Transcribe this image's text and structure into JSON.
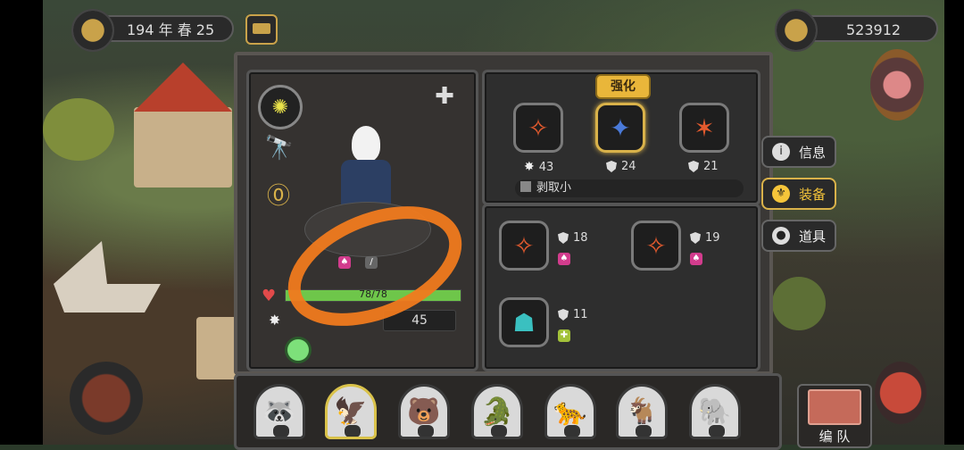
{
  "top": {
    "date": "194 年 春 25",
    "coins": "523912"
  },
  "hero": {
    "hp_text": "78/78",
    "hp_fraction": 1.0,
    "attack_value": "45"
  },
  "equip_panel": {
    "upgrade_label": "强化",
    "equipped": [
      {
        "value": "43",
        "stat": "attack"
      },
      {
        "value": "24",
        "stat": "defense",
        "selected": true
      },
      {
        "value": "21",
        "stat": "defense"
      }
    ],
    "skill_label": "剥取小"
  },
  "inventory": [
    {
      "value": "18",
      "tag": "pink"
    },
    {
      "value": "19",
      "tag": "pink"
    },
    {
      "value": "11",
      "tag": "green"
    }
  ],
  "tabs": [
    {
      "label": "信息",
      "icon": "info-icon"
    },
    {
      "label": "装备",
      "icon": "equip-icon",
      "active": true
    },
    {
      "label": "道具",
      "icon": "item-icon"
    }
  ],
  "team_button": "编 队",
  "colors": {
    "accent": "#d9b24a",
    "hp": "#6ec64a",
    "annotation": "#f07a1e"
  }
}
